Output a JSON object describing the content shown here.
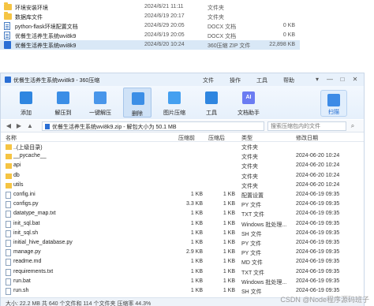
{
  "explorer": {
    "rows": [
      {
        "name": "环境安装环境",
        "date": "2024/6/21 11:11",
        "type": "文件夹",
        "size": "",
        "icon": "folder-icon"
      },
      {
        "name": "数据库文件",
        "date": "2024/6/19 20:17",
        "type": "文件夹",
        "size": "",
        "icon": "folder-icon"
      },
      {
        "name": "python-flask环境配置文档",
        "date": "2024/6/29 20:05",
        "type": "DOCX 文档",
        "size": "0 KB",
        "icon": "docx-icon"
      },
      {
        "name": "优餐生活养生系统wvi8k9",
        "date": "2024/6/19 20:05",
        "type": "DOCX 文档",
        "size": "0 KB",
        "icon": "docx-icon"
      },
      {
        "name": "优餐生活养生系统wvi8k9",
        "date": "2024/6/20 10:24",
        "type": "360压缩 ZIP 文件",
        "size": "22,898 KB",
        "icon": "zip-icon"
      }
    ]
  },
  "window": {
    "title": "优餐生活养生系统wvi8k9 - 360压缩",
    "menu": [
      "文件",
      "操作",
      "工具",
      "帮助"
    ]
  },
  "toolbar": {
    "items": [
      {
        "label": "添加",
        "color": "#2f86e0",
        "icon": "add-icon"
      },
      {
        "label": "解压到",
        "color": "#3b8ee6",
        "icon": "extract-icon"
      },
      {
        "label": "一键解压",
        "color": "#4996ea",
        "icon": "one-click-extract-icon"
      },
      {
        "label": "删除",
        "color": "#3b8ee6",
        "icon": "delete-icon"
      },
      {
        "label": "图片压缩",
        "color": "#45a0f0",
        "icon": "image-compress-icon"
      },
      {
        "label": "工具",
        "color": "#2f86e0",
        "icon": "tools-icon"
      },
      {
        "label": "文档助手",
        "color": "#6b7cf2",
        "icon": "ai-icon"
      }
    ],
    "scan_label": "扫描"
  },
  "address": {
    "path": "优餐生活养生系统wvi8k9.zip - 解包大小为 50.1 MB",
    "search_placeholder": "搜索压缩包内的文件"
  },
  "columns": {
    "name": "名称",
    "compressed": "压缩前",
    "size": "压缩后",
    "type": "类型",
    "modified": "修改日期"
  },
  "files": [
    {
      "name": "..(上级目录)",
      "c1": "",
      "c2": "",
      "type": "文件夹",
      "date": "",
      "kind": "folder"
    },
    {
      "name": "__pycache__",
      "c1": "",
      "c2": "",
      "type": "文件夹",
      "date": "2024-06-20 10:24",
      "kind": "folder"
    },
    {
      "name": "api",
      "c1": "",
      "c2": "",
      "type": "文件夹",
      "date": "2024-06-20 10:24",
      "kind": "folder"
    },
    {
      "name": "db",
      "c1": "",
      "c2": "",
      "type": "文件夹",
      "date": "2024-06-20 10:24",
      "kind": "folder"
    },
    {
      "name": "utils",
      "c1": "",
      "c2": "",
      "type": "文件夹",
      "date": "2024-06-20 10:24",
      "kind": "folder"
    },
    {
      "name": "config.ini",
      "c1": "1 KB",
      "c2": "1 KB",
      "type": "配置设置",
      "date": "2024-06-19 09:35",
      "kind": "file"
    },
    {
      "name": "configs.py",
      "c1": "3.3 KB",
      "c2": "1 KB",
      "type": "PY 文件",
      "date": "2024-06-19 09:35",
      "kind": "file"
    },
    {
      "name": "datatype_map.txt",
      "c1": "1 KB",
      "c2": "1 KB",
      "type": "TXT 文件",
      "date": "2024-06-19 09:35",
      "kind": "file"
    },
    {
      "name": "init_sql.bat",
      "c1": "1 KB",
      "c2": "1 KB",
      "type": "Windows 批处理...",
      "date": "2024-06-19 09:35",
      "kind": "file"
    },
    {
      "name": "init_sql.sh",
      "c1": "1 KB",
      "c2": "1 KB",
      "type": "SH 文件",
      "date": "2024-06-19 09:35",
      "kind": "file"
    },
    {
      "name": "initial_hive_database.py",
      "c1": "1 KB",
      "c2": "1 KB",
      "type": "PY 文件",
      "date": "2024-06-19 09:35",
      "kind": "file"
    },
    {
      "name": "manage.py",
      "c1": "2.9 KB",
      "c2": "1 KB",
      "type": "PY 文件",
      "date": "2024-06-19 09:35",
      "kind": "file"
    },
    {
      "name": "readme.md",
      "c1": "1 KB",
      "c2": "1 KB",
      "type": "MD 文件",
      "date": "2024-06-19 09:35",
      "kind": "file"
    },
    {
      "name": "requirements.txt",
      "c1": "1 KB",
      "c2": "1 KB",
      "type": "TXT 文件",
      "date": "2024-06-19 09:35",
      "kind": "file"
    },
    {
      "name": "run.bat",
      "c1": "1 KB",
      "c2": "1 KB",
      "type": "Windows 批处理...",
      "date": "2024-06-19 09:35",
      "kind": "file"
    },
    {
      "name": "run.sh",
      "c1": "1 KB",
      "c2": "1 KB",
      "type": "SH 文件",
      "date": "2024-06-19 09:35",
      "kind": "file"
    }
  ],
  "status": "大小: 22.2 MB 共 640 个文件和 114 个文件夹 压缩率 44.3%",
  "watermark": "CSDN @Node程序源码班子"
}
